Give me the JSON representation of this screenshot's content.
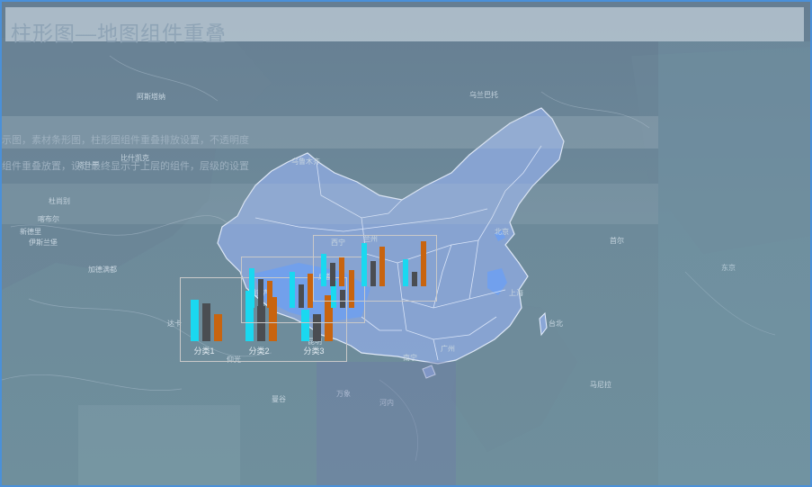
{
  "title": "柱形图—地图组件重叠",
  "description_lines": [
    "示图，素材条形图，柱形图组件重叠排放设置，不透明度",
    "组件重叠放置，设定最终显示于上层的组件，层级的设置"
  ],
  "colors": {
    "frame_border": "#4a90d9",
    "map_fill": "#8aa6d6",
    "map_border": "#e8f0ff",
    "highlight_province": "#6fa0f0",
    "series_cyan": "#1ad8f0",
    "series_dark": "#4a4d52",
    "series_orange": "#c8640f"
  },
  "map_labels": [
    "乌鲁木齐",
    "拉萨",
    "北京",
    "上海",
    "广州",
    "成都",
    "西宁",
    "兰州",
    "昆明",
    "南宁",
    "台北",
    "首尔",
    "东京",
    "新德里",
    "加德满都",
    "达卡",
    "曼谷",
    "河内",
    "仰光",
    "万象",
    "乌兰巴托",
    "阿斯塔纳",
    "比什凯克",
    "塔什干",
    "杜尚别",
    "喀布尔",
    "伊斯兰堡",
    "马尼拉"
  ],
  "charts": [
    {
      "id": "chart-left",
      "chart_data": {
        "type": "bar",
        "categories": [
          "分类1",
          "分类2",
          "分类3"
        ],
        "series": [
          {
            "values": [
              40,
              48,
              30
            ]
          },
          {
            "values": [
              36,
              34,
              26
            ]
          },
          {
            "values": [
              26,
              42,
              44
            ]
          }
        ],
        "ylim": [
          0,
          50
        ]
      }
    },
    {
      "id": "chart-mid",
      "chart_data": {
        "type": "bar",
        "categories": [
          "分类1",
          "分类2",
          "分类3"
        ],
        "series": [
          {
            "values": [
              44,
              40,
              30
            ]
          },
          {
            "values": [
              32,
              26,
              20
            ]
          },
          {
            "values": [
              30,
              38,
              42
            ]
          }
        ],
        "ylim": [
          0,
          50
        ]
      }
    },
    {
      "id": "chart-top",
      "chart_data": {
        "type": "bar",
        "categories": [
          "分类1",
          "分类2",
          "分类3"
        ],
        "series": [
          {
            "values": [
              36,
              48,
              30
            ]
          },
          {
            "values": [
              26,
              28,
              16
            ]
          },
          {
            "values": [
              32,
              44,
              50
            ]
          }
        ],
        "ylim": [
          0,
          50
        ]
      }
    }
  ]
}
